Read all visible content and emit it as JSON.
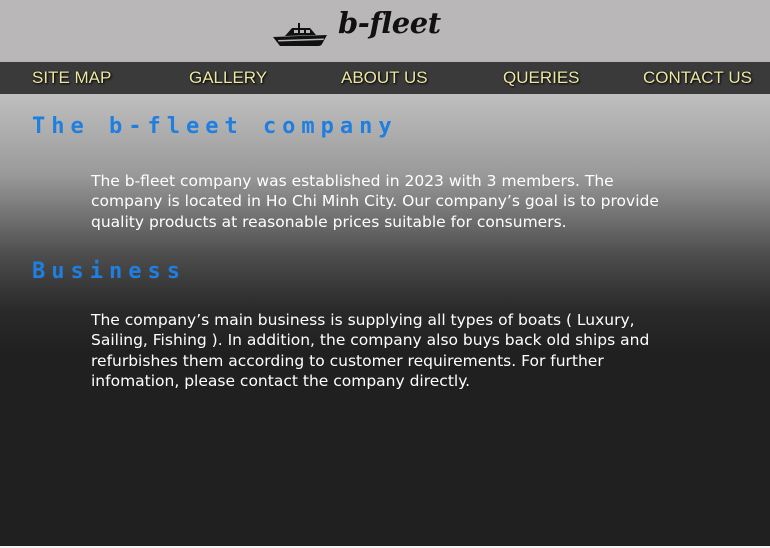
{
  "brand": {
    "logo_text": "b-fleet",
    "logo_icon": "boat-icon"
  },
  "nav": {
    "items": [
      {
        "label": "SITE MAP"
      },
      {
        "label": "GALLERY"
      },
      {
        "label": "ABOUT US"
      },
      {
        "label": "QUERIES"
      },
      {
        "label": "CONTACT US"
      }
    ]
  },
  "sections": [
    {
      "heading": "The b-fleet company",
      "body": "The b-fleet company was established in 2023 with 3 members. The company is located in Ho Chi Minh City. Our company’s goal is to provide quality products at reasonable prices suitable for consumers."
    },
    {
      "heading": "Business",
      "body": "The company’s main business is supplying all types of boats ( Luxury, Sailing, Fishing ). In addition, the company also buys back old ships and refurbishes them according to customer requirements. For further infomation, please contact the company directly."
    }
  ],
  "colors": {
    "header_bg": "#bab7b8",
    "nav_bg": "#3a3a3a",
    "nav_text": "#ede7a4",
    "heading": "#1f7fe0",
    "body_text": "#ffffff",
    "content_bottom": "#202020"
  }
}
